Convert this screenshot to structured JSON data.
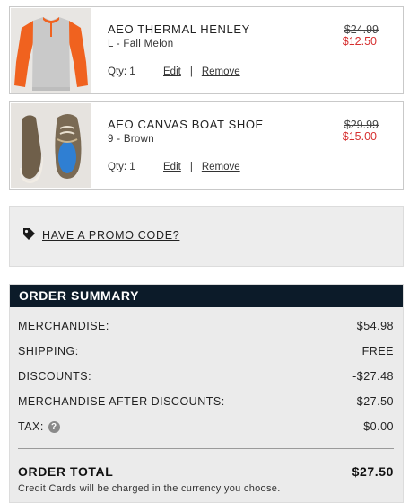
{
  "cart": {
    "items": [
      {
        "name": "AEO THERMAL HENLEY",
        "variant": "L - Fall Melon",
        "qty": "Qty: 1",
        "edit": "Edit",
        "separator": "|",
        "remove": "Remove",
        "price_original": "$24.99",
        "price_sale": "$12.50",
        "image": "thermal-henley-shirt-image"
      },
      {
        "name": "AEO CANVAS BOAT SHOE",
        "variant": "9 - Brown",
        "qty": "Qty: 1",
        "edit": "Edit",
        "separator": "|",
        "remove": "Remove",
        "price_original": "$29.99",
        "price_sale": "$15.00",
        "image": "canvas-boat-shoe-image"
      }
    ]
  },
  "promo": {
    "icon": "tag-icon",
    "label": "HAVE A PROMO CODE?"
  },
  "summary": {
    "title": "ORDER SUMMARY",
    "rows": [
      {
        "label": "MERCHANDISE:",
        "value": "$54.98"
      },
      {
        "label": "SHIPPING:",
        "value": "FREE"
      },
      {
        "label": "DISCOUNTS:",
        "value": "-$27.48"
      },
      {
        "label": "MERCHANDISE AFTER DISCOUNTS:",
        "value": "$27.50"
      },
      {
        "label": "TAX:",
        "value": "$0.00",
        "help_icon": "?"
      }
    ],
    "total_label": "ORDER TOTAL",
    "total_value": "$27.50",
    "note": "Credit Cards will be charged in the currency you choose."
  },
  "colors": {
    "sale_price": "#d62f2f",
    "summary_header": "#0c1b29",
    "panel_bg": "#ebebeb"
  }
}
